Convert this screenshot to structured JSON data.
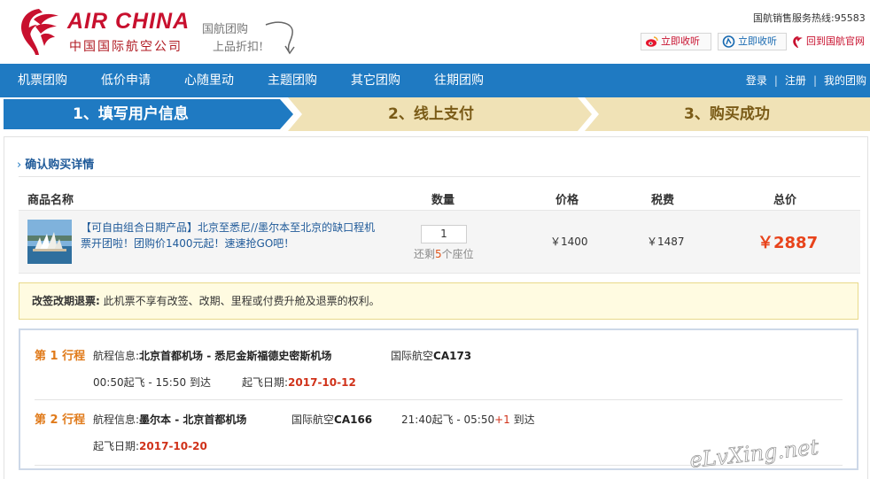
{
  "header": {
    "brand_en": "AIR CHINA",
    "brand_cn": "中国国际航空公司",
    "promo_line1": "国航团购",
    "promo_line2": "上品折扣!",
    "hotline": "国航销售服务热线:95583",
    "weibo_button": "立即收听",
    "qq_button": "立即收听",
    "home_link": "回到国航官网",
    "icons": {
      "logo": "air-china-phoenix-logo",
      "weibo": "weibo-icon",
      "qq": "qq-weibo-icon",
      "home": "phoenix-small-icon",
      "promo": "arrow-icon"
    },
    "brand_color": "#c8102e"
  },
  "nav": {
    "items": [
      "机票团购",
      "低价申请",
      "心随里动",
      "主题团购",
      "其它团购",
      "往期团购"
    ],
    "login": "登录",
    "register": "注册",
    "my_groupbuy": "我的团购",
    "separator": "|",
    "bg_color": "#1f7ac2"
  },
  "steps": [
    {
      "label": "1、填写用户信息",
      "active": true
    },
    {
      "label": "2、线上支付",
      "active": false
    },
    {
      "label": "3、购买成功",
      "active": false
    }
  ],
  "order": {
    "section_title": "确认购买详情",
    "columns": [
      "商品名称",
      "数量",
      "价格",
      "税费",
      "总价"
    ],
    "product_text": "【可自由组合日期产品】北京至悉尼//墨尔本至北京的缺口程机票开团啦！团购价1400元起！速速抢GO吧！",
    "quantity": "1",
    "remaining_prefix": "还剩",
    "remaining_count": "5",
    "remaining_suffix": "个座位",
    "price": "￥1400",
    "tax": "￥1487",
    "total": "￥2887"
  },
  "notice": {
    "label": "改签改期退票:",
    "text": " 此机票不享有改签、改期、里程或付费升舱及退票的权利。"
  },
  "itinerary": [
    {
      "label": "第 1 行程",
      "info_label": "航程信息:",
      "route": "北京首都机场 - 悉尼金斯福德史密斯机场",
      "airline_prefix": "国际航空",
      "flight": "CA173",
      "times": "00:50起飞 - 15:50 到达",
      "date_label": "起飞日期:",
      "date": "2017-10-12"
    },
    {
      "label": "第 2 行程",
      "info_label": "航程信息:",
      "route": "墨尔本 - 北京首都机场",
      "airline_prefix": "国际航空",
      "flight": "CA166",
      "times_dep": "21:40起飞 - 05:50",
      "times_plus": "+1",
      "times_arr": " 到达",
      "date_label": "起飞日期:",
      "date": "2017-10-20"
    }
  ],
  "watermark": "eLvXing.net"
}
